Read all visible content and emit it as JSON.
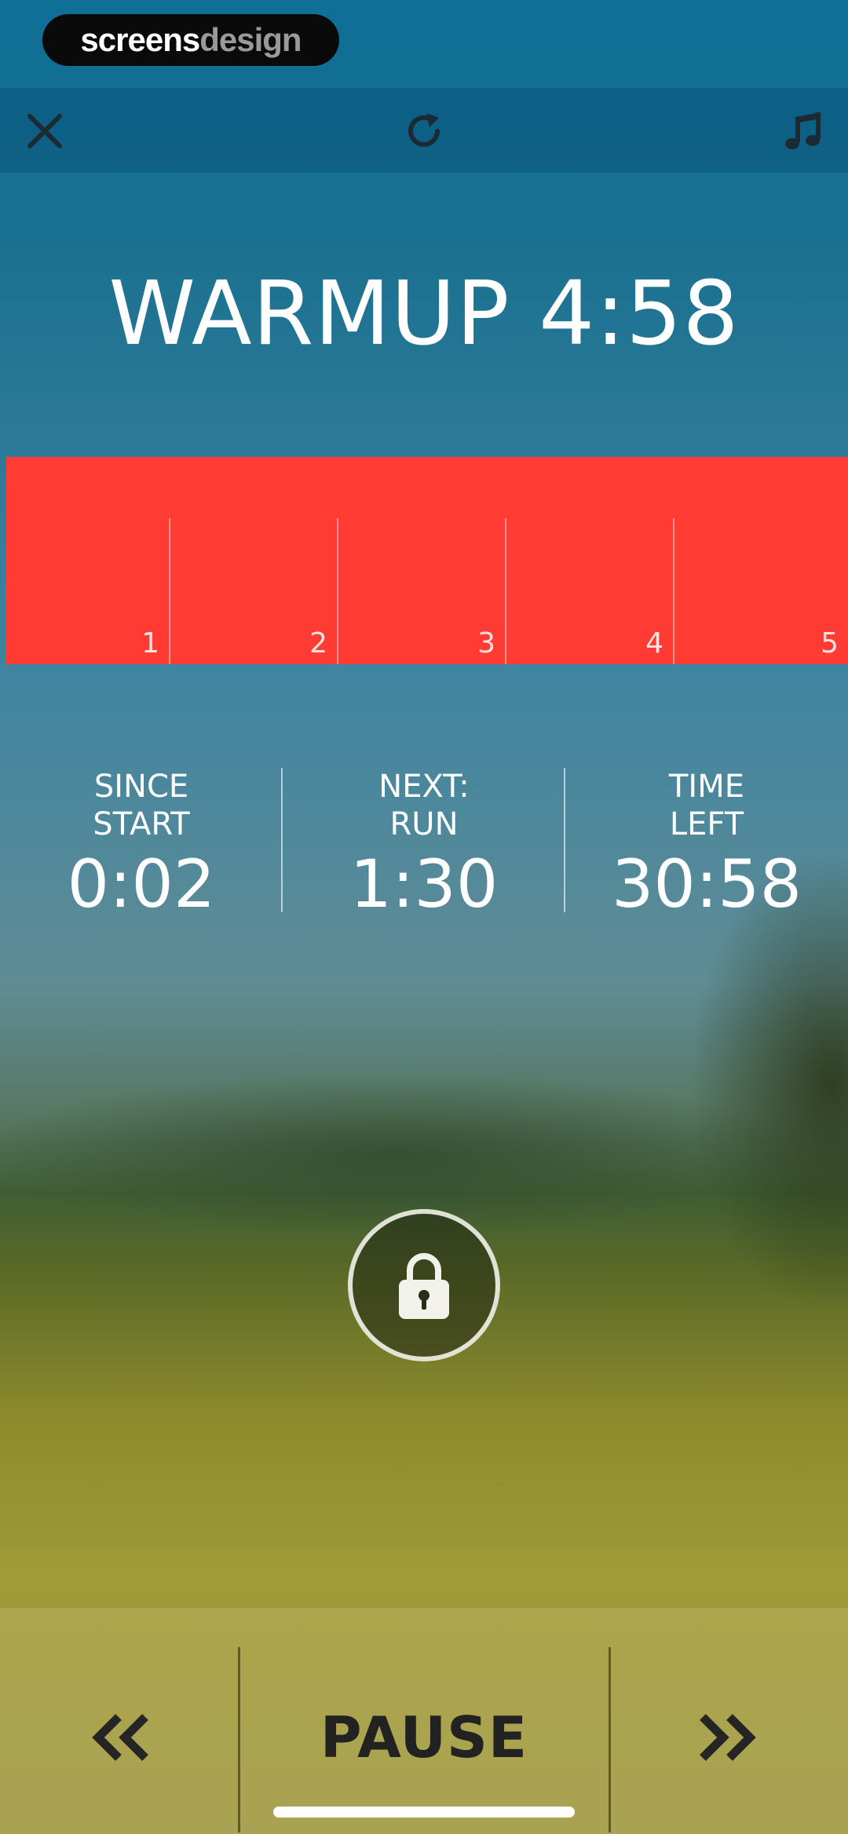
{
  "brand": {
    "part1": "screens",
    "part2": "design"
  },
  "toolbar": {
    "close_icon": "close-icon",
    "refresh_icon": "refresh-icon",
    "music_icon": "music-note-icon"
  },
  "phase": {
    "title": "WARMUP 4:58"
  },
  "segments": {
    "color": "#ff3b33",
    "labels": [
      "1",
      "2",
      "3",
      "4",
      "5"
    ]
  },
  "stats": {
    "since_start": {
      "label_line1": "SINCE",
      "label_line2": "START",
      "value": "0:02"
    },
    "next": {
      "label_line1": "NEXT:",
      "label_line2": "RUN",
      "value": "1:30"
    },
    "time_left": {
      "label_line1": "TIME",
      "label_line2": "LEFT",
      "value": "30:58"
    }
  },
  "lock": {
    "icon": "lock-icon"
  },
  "controls": {
    "prev_icon": "double-chevron-left-icon",
    "pause_label": "PAUSE",
    "next_icon": "double-chevron-right-icon"
  }
}
